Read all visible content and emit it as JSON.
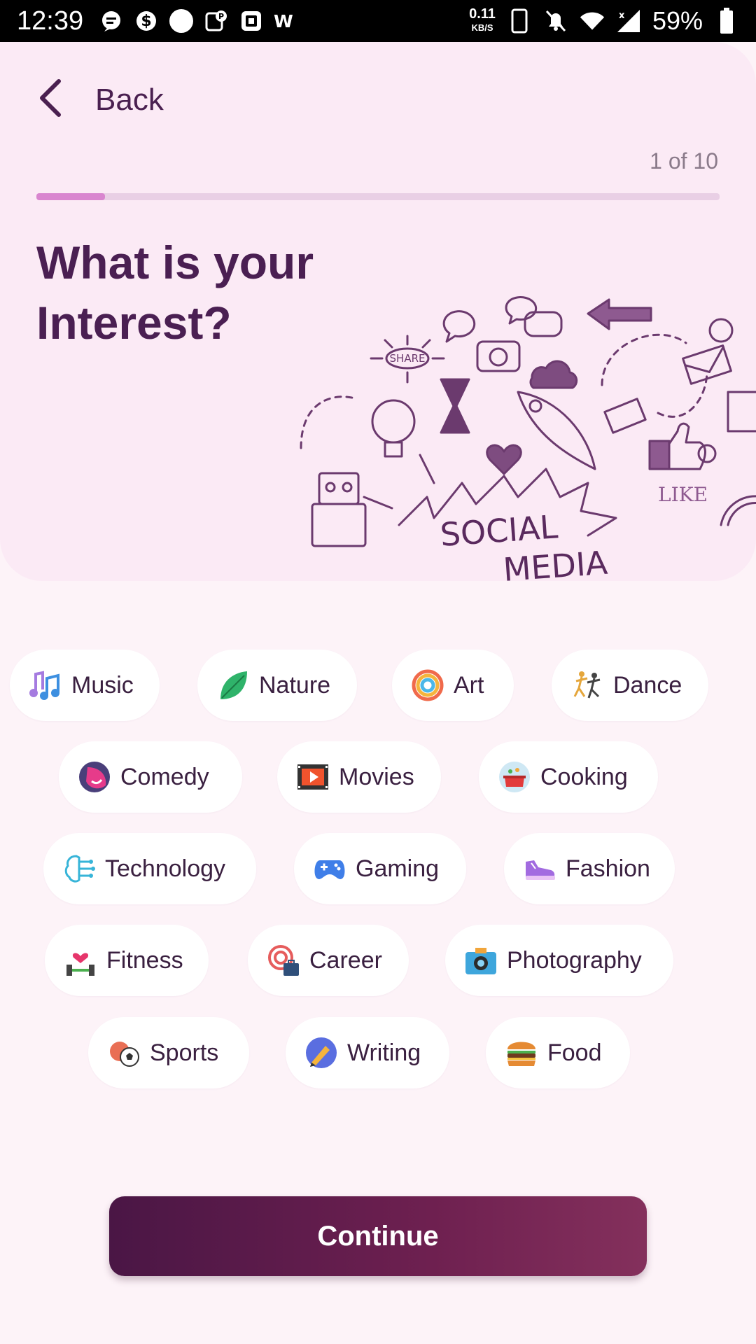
{
  "status_bar": {
    "time": "12:39",
    "speed_value": "0.11",
    "speed_unit": "KB/S",
    "battery": "59%"
  },
  "header": {
    "back_label": "Back",
    "step_text": "1 of 10",
    "progress": 0.1,
    "title_line1": "What is your",
    "title_line2": "Interest?"
  },
  "illustration": {
    "word_social": "SOCIAL",
    "word_media": "MEDIA",
    "word_like": "LIKE",
    "word_share": "SHARE"
  },
  "interests": [
    {
      "label": "Music",
      "icon": "music-notes-icon"
    },
    {
      "label": "Nature",
      "icon": "leaf-icon"
    },
    {
      "label": "Art",
      "icon": "rainbow-icon"
    },
    {
      "label": "Dance",
      "icon": "dancers-icon"
    },
    {
      "label": "Comedy",
      "icon": "comedy-mask-icon"
    },
    {
      "label": "Movies",
      "icon": "film-play-icon"
    },
    {
      "label": "Cooking",
      "icon": "cooking-pot-icon"
    },
    {
      "label": "Technology",
      "icon": "circuit-brain-icon"
    },
    {
      "label": "Gaming",
      "icon": "gamepad-icon"
    },
    {
      "label": "Fashion",
      "icon": "sneaker-icon"
    },
    {
      "label": "Fitness",
      "icon": "dumbbell-heart-icon"
    },
    {
      "label": "Career",
      "icon": "target-briefcase-icon"
    },
    {
      "label": "Photography",
      "icon": "camera-icon"
    },
    {
      "label": "Sports",
      "icon": "sports-balls-icon"
    },
    {
      "label": "Writing",
      "icon": "pen-globe-icon"
    },
    {
      "label": "Food",
      "icon": "burger-icon"
    }
  ],
  "continue_label": "Continue"
}
